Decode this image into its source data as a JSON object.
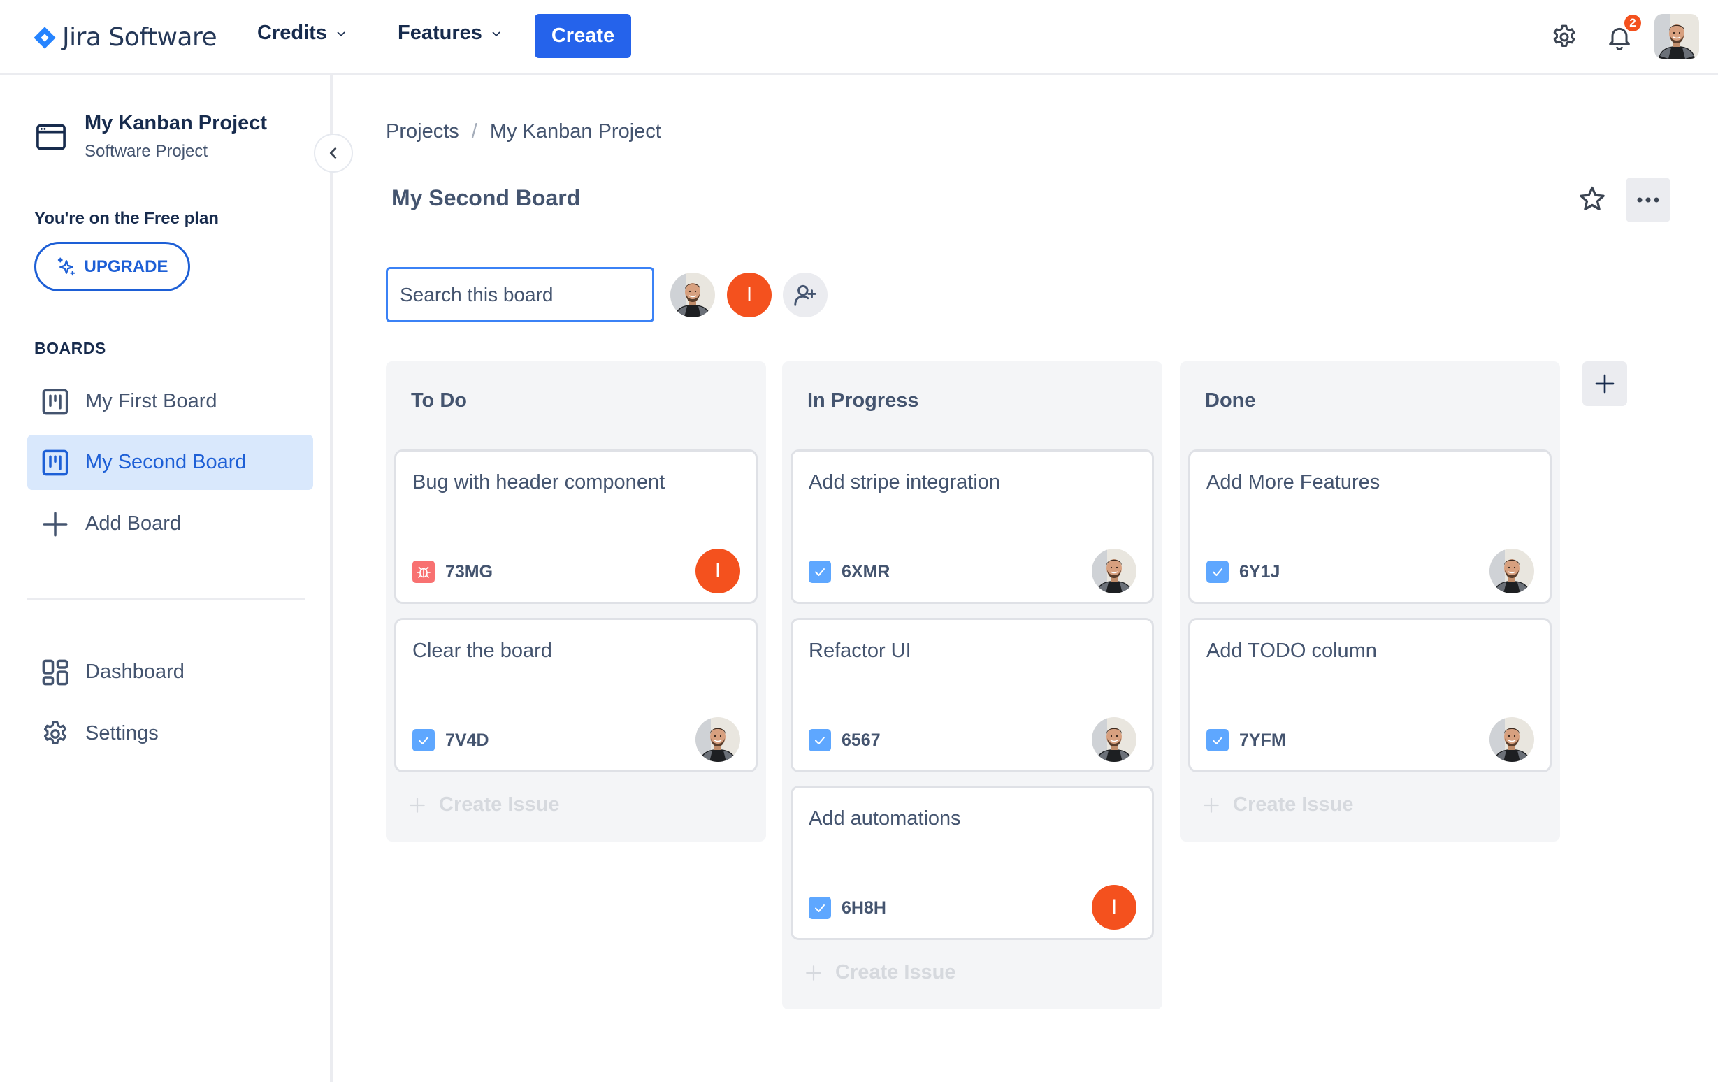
{
  "header": {
    "app_name": "Jira Software",
    "nav": [
      {
        "label": "Credits",
        "icon": "chevron-down-icon"
      },
      {
        "label": "Features",
        "icon": "chevron-down-icon"
      }
    ],
    "create_label": "Create",
    "notification_count": "2",
    "icons": [
      "gear-icon",
      "bell-icon",
      "user-avatar"
    ]
  },
  "sidebar": {
    "project_title": "My Kanban Project",
    "project_subtitle": "Software Project",
    "plan_text": "You're on the Free plan",
    "upgrade_label": "UPGRADE",
    "boards_heading": "BOARDS",
    "boards": [
      {
        "label": "My First Board",
        "active": false
      },
      {
        "label": "My Second Board",
        "active": true
      }
    ],
    "add_board_label": "Add Board",
    "bottom_items": [
      {
        "label": "Dashboard",
        "icon": "dashboard-icon"
      },
      {
        "label": "Settings",
        "icon": "gear-icon"
      }
    ]
  },
  "main": {
    "breadcrumb": [
      "Projects",
      "My Kanban Project"
    ],
    "breadcrumb_separator": "/",
    "board_title": "My Second Board",
    "search_placeholder": "Search this board",
    "members": [
      {
        "type": "photo"
      },
      {
        "type": "initial",
        "initial": "I"
      }
    ],
    "columns": [
      {
        "title": "To Do",
        "cards": [
          {
            "title": "Bug with header component",
            "key": "73MG",
            "type": "bug",
            "assignee": "initial",
            "initial": "I"
          },
          {
            "title": "Clear the board",
            "key": "7V4D",
            "type": "task",
            "assignee": "photo"
          }
        ],
        "create_label": "Create Issue"
      },
      {
        "title": "In Progress",
        "cards": [
          {
            "title": "Add stripe integration",
            "key": "6XMR",
            "type": "task",
            "assignee": "photo"
          },
          {
            "title": "Refactor UI",
            "key": "6567",
            "type": "task",
            "assignee": "photo"
          },
          {
            "title": "Add automations",
            "key": "6H8H",
            "type": "task",
            "assignee": "initial",
            "initial": "I"
          }
        ],
        "create_label": "Create Issue"
      },
      {
        "title": "Done",
        "cards": [
          {
            "title": "Add More Features",
            "key": "6Y1J",
            "type": "task",
            "assignee": "photo"
          },
          {
            "title": "Add TODO column",
            "key": "7YFM",
            "type": "task",
            "assignee": "photo"
          }
        ],
        "create_label": "Create Issue"
      }
    ]
  },
  "colors": {
    "primary": "#2563eb",
    "accent_blue": "#1d5fd6",
    "active_bg": "#d9e8fc",
    "avatar_orange": "#f4511e",
    "task_icon": "#5ea7ff",
    "bug_icon": "#f87171",
    "column_bg": "#f4f5f7"
  }
}
